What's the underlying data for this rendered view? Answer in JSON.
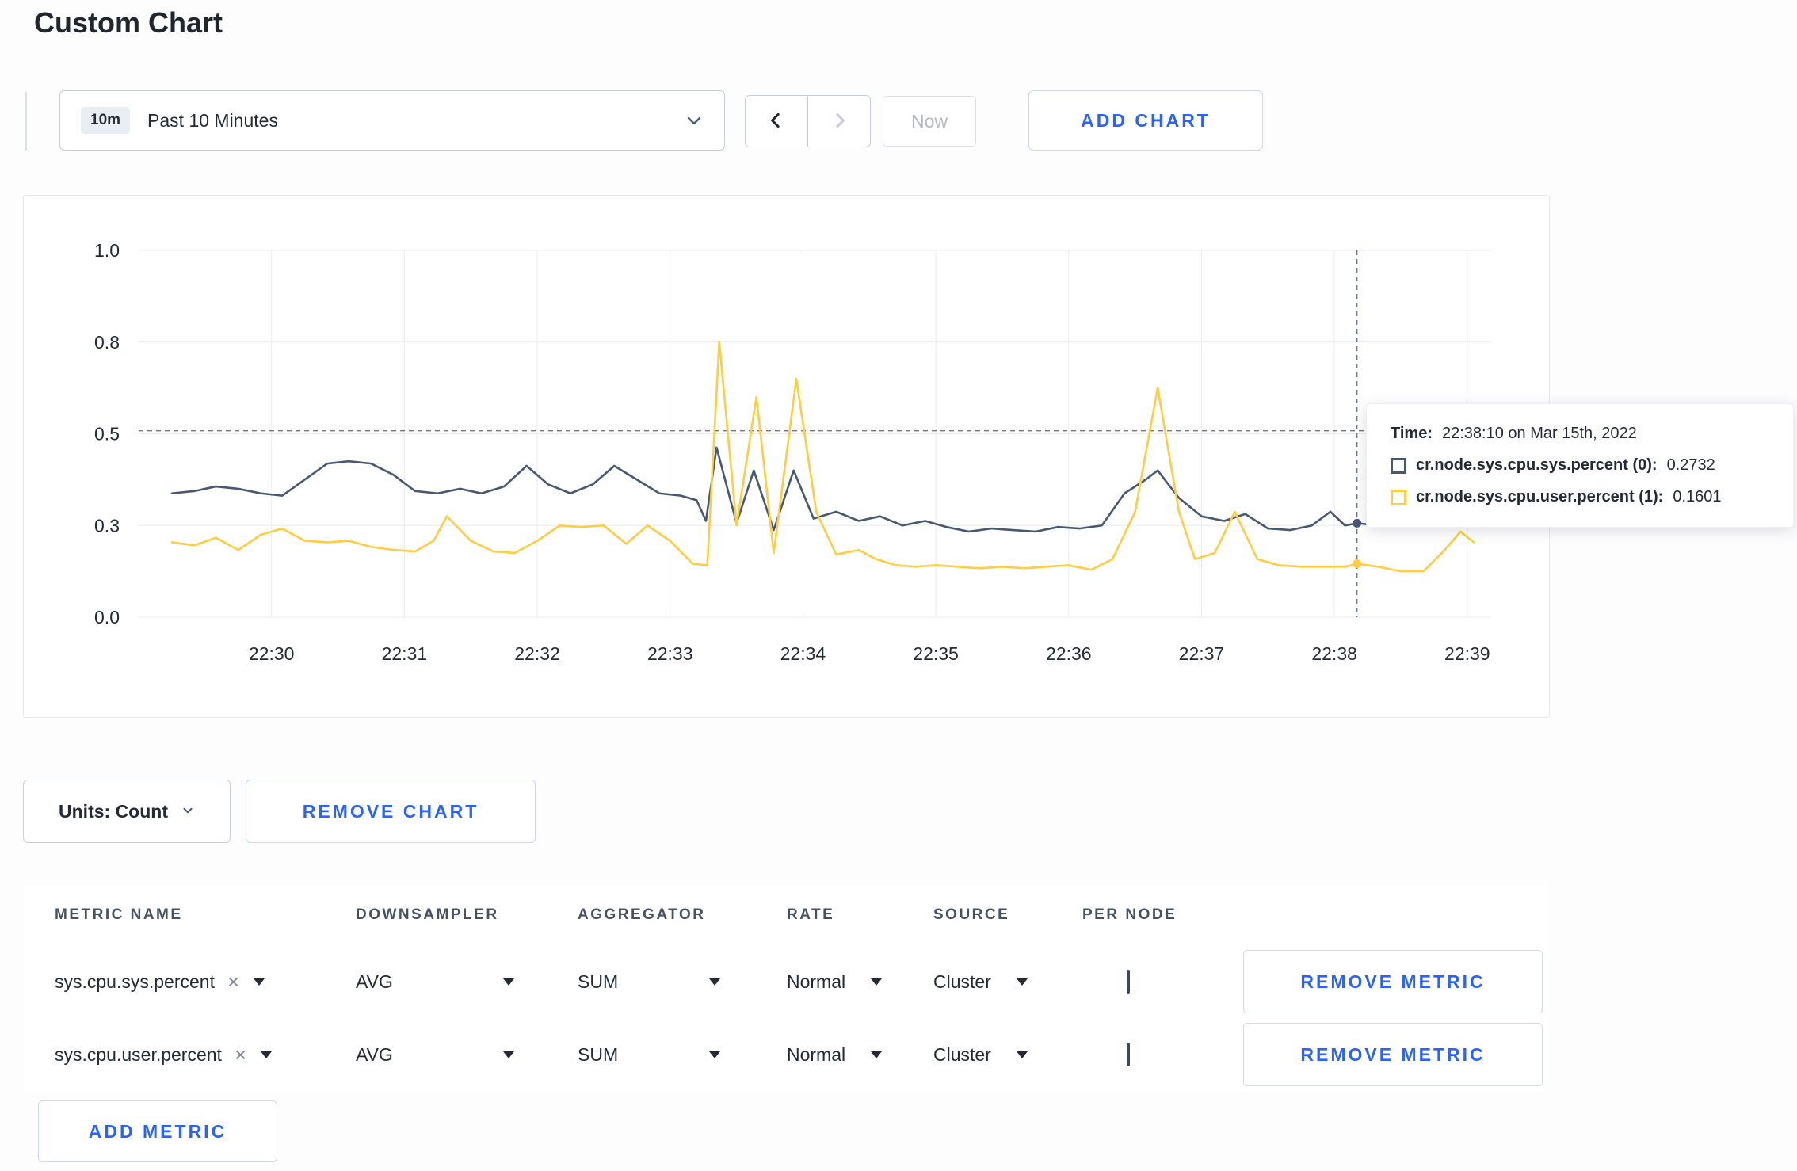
{
  "page": {
    "title": "Custom Chart"
  },
  "colors": {
    "accent_blue": "#2962ff",
    "series_sys": "#475872",
    "series_user": "#ffcd3f",
    "gridline": "#eaecf1",
    "crosshair": "#6f7889"
  },
  "icons": {
    "time_dropdown": "chevron-down",
    "prev": "chevron-left",
    "next": "chevron-right",
    "units_dropdown": "chevron-down",
    "metric_clear": "×",
    "select_caret": "caret-down"
  },
  "toolbar": {
    "time_window": {
      "badge": "10m",
      "label": "Past 10 Minutes"
    },
    "now_label": "Now",
    "add_chart_label": "ADD CHART"
  },
  "chart_controls": {
    "units_label": "Units: Count",
    "remove_chart_label": "REMOVE CHART",
    "add_metric_label": "ADD METRIC"
  },
  "tooltip": {
    "time_label": "Time:",
    "time_value": "22:38:10 on Mar 15th, 2022",
    "series": [
      {
        "name": "cr.node.sys.cpu.sys.percent (0):",
        "value": "0.2732"
      },
      {
        "name": "cr.node.sys.cpu.user.percent (1):",
        "value": "0.1601"
      }
    ]
  },
  "metrics_table": {
    "headers": [
      "METRIC NAME",
      "DOWNSAMPLER",
      "AGGREGATOR",
      "RATE",
      "SOURCE",
      "PER NODE"
    ],
    "remove_metric_label": "REMOVE METRIC",
    "rows": [
      {
        "metric": "sys.cpu.sys.percent",
        "downsampler": "AVG",
        "aggregator": "SUM",
        "rate": "Normal",
        "source": "Cluster",
        "per_node": false
      },
      {
        "metric": "sys.cpu.user.percent",
        "downsampler": "AVG",
        "aggregator": "SUM",
        "rate": "Normal",
        "source": "Cluster",
        "per_node": false
      }
    ]
  },
  "chart_data": {
    "type": "line",
    "title": "",
    "xlabel": "",
    "ylabel": "",
    "x_ticks": [
      "22:30",
      "22:31",
      "22:32",
      "22:33",
      "22:34",
      "22:35",
      "22:36",
      "22:37",
      "22:38",
      "22:39"
    ],
    "y_ticks": [
      0.0,
      0.3,
      0.5,
      0.8,
      1.0
    ],
    "y_tick_labels": [
      "0.0",
      "0.3",
      "0.5",
      "0.8",
      "1.0"
    ],
    "x_range_minutes": [
      -1,
      9.18
    ],
    "grid": true,
    "legend_position": "none",
    "crosshair": {
      "t": 8.17,
      "value_line": 0.51
    },
    "series": [
      {
        "name": "cr.node.sys.cpu.sys.percent",
        "color": "#475872",
        "points": [
          [
            -0.75,
            0.37
          ],
          [
            -0.58,
            0.375
          ],
          [
            -0.42,
            0.385
          ],
          [
            -0.25,
            0.38
          ],
          [
            -0.08,
            0.37
          ],
          [
            0.08,
            0.365
          ],
          [
            0.25,
            0.4
          ],
          [
            0.42,
            0.435
          ],
          [
            0.58,
            0.44
          ],
          [
            0.75,
            0.435
          ],
          [
            0.92,
            0.41
          ],
          [
            1.08,
            0.375
          ],
          [
            1.25,
            0.37
          ],
          [
            1.42,
            0.38
          ],
          [
            1.58,
            0.37
          ],
          [
            1.75,
            0.385
          ],
          [
            1.92,
            0.43
          ],
          [
            2.08,
            0.39
          ],
          [
            2.25,
            0.37
          ],
          [
            2.42,
            0.39
          ],
          [
            2.58,
            0.43
          ],
          [
            2.75,
            0.4
          ],
          [
            2.92,
            0.37
          ],
          [
            3.08,
            0.365
          ],
          [
            3.2,
            0.355
          ],
          [
            3.27,
            0.31
          ],
          [
            3.35,
            0.47
          ],
          [
            3.5,
            0.305
          ],
          [
            3.63,
            0.42
          ],
          [
            3.78,
            0.285
          ],
          [
            3.93,
            0.42
          ],
          [
            4.08,
            0.315
          ],
          [
            4.25,
            0.33
          ],
          [
            4.42,
            0.31
          ],
          [
            4.58,
            0.32
          ],
          [
            4.75,
            0.3
          ],
          [
            4.92,
            0.31
          ],
          [
            5.08,
            0.295
          ],
          [
            5.25,
            0.28
          ],
          [
            5.42,
            0.29
          ],
          [
            5.58,
            0.285
          ],
          [
            5.75,
            0.28
          ],
          [
            5.92,
            0.295
          ],
          [
            6.08,
            0.29
          ],
          [
            6.25,
            0.3
          ],
          [
            6.42,
            0.37
          ],
          [
            6.58,
            0.4
          ],
          [
            6.67,
            0.42
          ],
          [
            6.83,
            0.36
          ],
          [
            7.0,
            0.32
          ],
          [
            7.17,
            0.31
          ],
          [
            7.33,
            0.325
          ],
          [
            7.5,
            0.29
          ],
          [
            7.67,
            0.285
          ],
          [
            7.83,
            0.3
          ],
          [
            7.97,
            0.33
          ],
          [
            8.08,
            0.3
          ],
          [
            8.17,
            0.305
          ],
          [
            8.33,
            0.3
          ],
          [
            8.5,
            0.315
          ],
          [
            8.67,
            0.3
          ],
          [
            8.83,
            0.305
          ],
          [
            9.0,
            0.31
          ]
        ]
      },
      {
        "name": "cr.node.sys.cpu.user.percent",
        "color": "#ffcd3f",
        "points": [
          [
            -0.75,
            0.245
          ],
          [
            -0.58,
            0.235
          ],
          [
            -0.42,
            0.26
          ],
          [
            -0.25,
            0.22
          ],
          [
            -0.08,
            0.27
          ],
          [
            0.08,
            0.29
          ],
          [
            0.25,
            0.25
          ],
          [
            0.42,
            0.245
          ],
          [
            0.58,
            0.25
          ],
          [
            0.75,
            0.23
          ],
          [
            0.92,
            0.22
          ],
          [
            1.08,
            0.215
          ],
          [
            1.22,
            0.25
          ],
          [
            1.32,
            0.32
          ],
          [
            1.5,
            0.25
          ],
          [
            1.67,
            0.215
          ],
          [
            1.83,
            0.21
          ],
          [
            2.0,
            0.25
          ],
          [
            2.17,
            0.3
          ],
          [
            2.33,
            0.295
          ],
          [
            2.5,
            0.3
          ],
          [
            2.67,
            0.24
          ],
          [
            2.83,
            0.3
          ],
          [
            3.0,
            0.25
          ],
          [
            3.17,
            0.175
          ],
          [
            3.28,
            0.17
          ],
          [
            3.37,
            0.8
          ],
          [
            3.5,
            0.3
          ],
          [
            3.65,
            0.62
          ],
          [
            3.78,
            0.21
          ],
          [
            3.95,
            0.68
          ],
          [
            4.1,
            0.33
          ],
          [
            4.25,
            0.205
          ],
          [
            4.42,
            0.22
          ],
          [
            4.55,
            0.19
          ],
          [
            4.7,
            0.17
          ],
          [
            4.85,
            0.165
          ],
          [
            5.0,
            0.17
          ],
          [
            5.17,
            0.165
          ],
          [
            5.33,
            0.16
          ],
          [
            5.5,
            0.165
          ],
          [
            5.67,
            0.16
          ],
          [
            5.83,
            0.165
          ],
          [
            6.0,
            0.17
          ],
          [
            6.17,
            0.155
          ],
          [
            6.33,
            0.19
          ],
          [
            6.5,
            0.33
          ],
          [
            6.67,
            0.65
          ],
          [
            6.83,
            0.33
          ],
          [
            6.95,
            0.19
          ],
          [
            7.1,
            0.21
          ],
          [
            7.25,
            0.33
          ],
          [
            7.42,
            0.19
          ],
          [
            7.58,
            0.17
          ],
          [
            7.75,
            0.165
          ],
          [
            7.92,
            0.165
          ],
          [
            8.08,
            0.165
          ],
          [
            8.17,
            0.175
          ],
          [
            8.33,
            0.165
          ],
          [
            8.5,
            0.15
          ],
          [
            8.67,
            0.15
          ],
          [
            8.83,
            0.22
          ],
          [
            8.95,
            0.28
          ],
          [
            9.05,
            0.245
          ]
        ]
      }
    ]
  }
}
